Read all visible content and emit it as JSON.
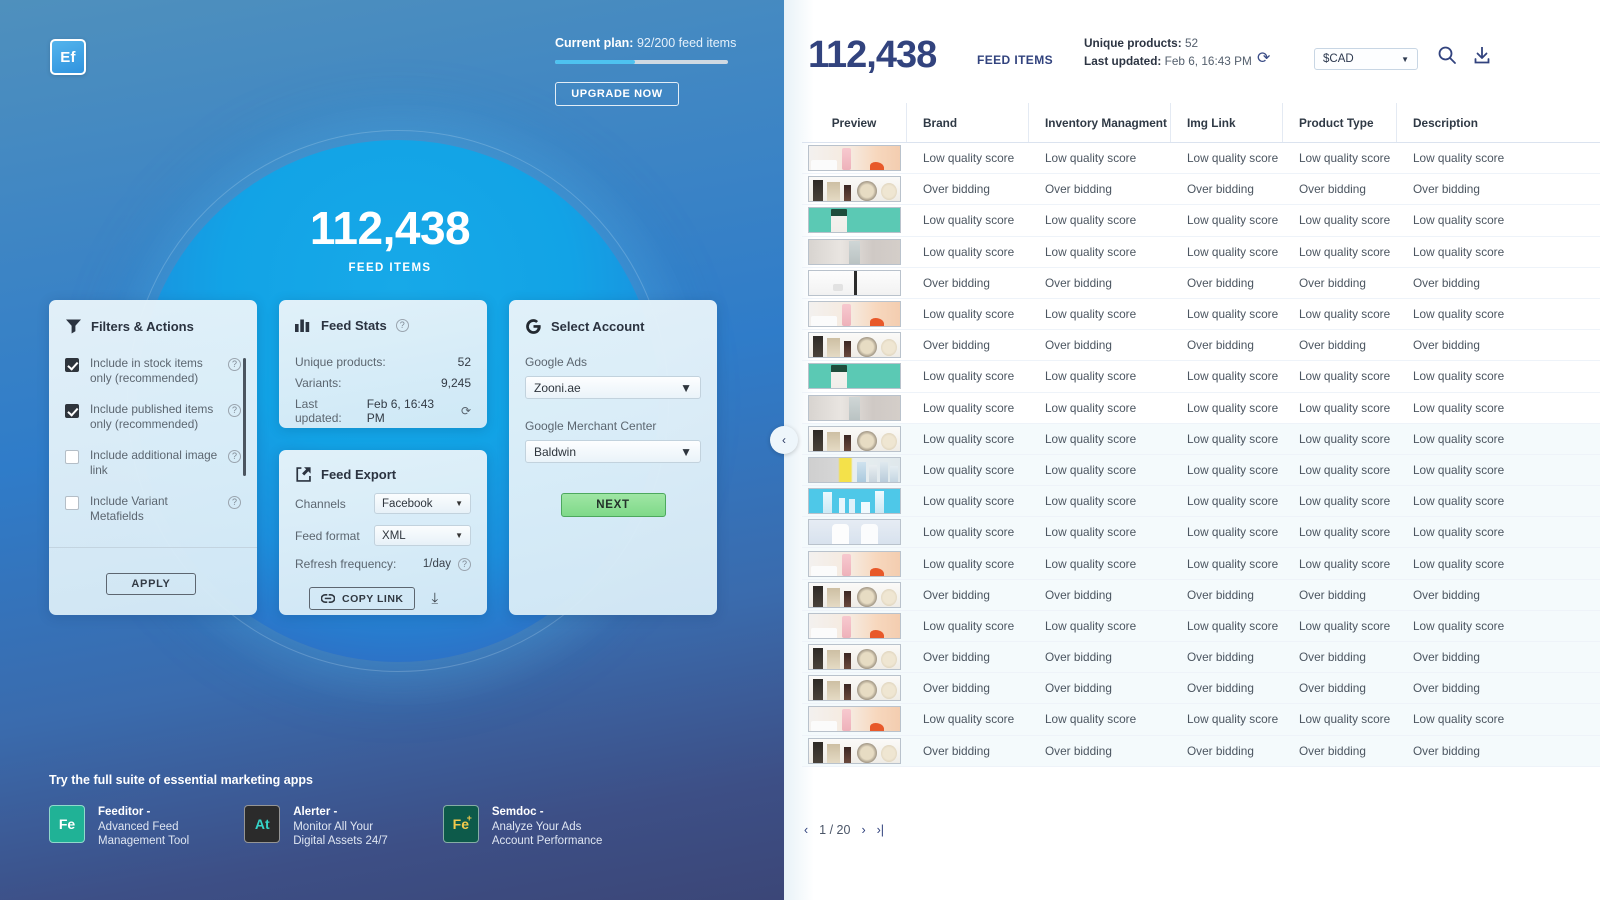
{
  "left": {
    "logo": "Ef",
    "plan": {
      "label": "Current plan:",
      "value": "92/200 feed items",
      "percent": 46
    },
    "upgrade_label": "UPGRADE NOW",
    "hero": {
      "number": "112,438",
      "label": "FEED ITEMS"
    },
    "filters_card": {
      "title": "Filters & Actions",
      "items": [
        {
          "label": "Include in stock items only (recommended)",
          "checked": true
        },
        {
          "label": "Include published items only (recommended)",
          "checked": true
        },
        {
          "label": "Include additional image link",
          "checked": false
        },
        {
          "label": "Include Variant Metafields",
          "checked": false
        }
      ],
      "apply_label": "APPLY"
    },
    "stats_card": {
      "title": "Feed Stats",
      "rows": [
        {
          "key": "Unique products:",
          "value": "52"
        },
        {
          "key": "Variants:",
          "value": "9,245"
        },
        {
          "key": "Last updated:",
          "value": "Feb 6, 16:43 PM"
        }
      ]
    },
    "export_card": {
      "title": "Feed Export",
      "channels_label": "Channels",
      "channels_value": "Facebook",
      "format_label": "Feed format",
      "format_value": "XML",
      "refresh_label": "Refresh frequency:",
      "refresh_value": "1/day",
      "copy_label": "COPY LINK"
    },
    "account_card": {
      "title": "Select Account",
      "google_ads_label": "Google Ads",
      "google_ads_value": "Zooni.ae",
      "gmc_label": "Google Merchant Center",
      "gmc_value": "Baldwin",
      "next_label": "NEXT"
    },
    "suite": {
      "title": "Try the full suite of essential marketing apps",
      "apps": [
        {
          "badge": "Fe",
          "sup": "",
          "name": "Feeditor -",
          "line1": "Advanced Feed",
          "line2": "Management Tool",
          "color": "#20b296",
          "text": "#ffffff"
        },
        {
          "badge": "At",
          "sup": "",
          "name": "Alerter -",
          "line1": "Monitor All Your",
          "line2": "Digital Assets 24/7",
          "color": "#2b2b2b",
          "text": "#35d4c8"
        },
        {
          "badge": "Fe",
          "sup": "+",
          "name": "Semdoc -",
          "line1": "Analyze Your Ads",
          "line2": "Account Performance",
          "color": "#0d5a4a",
          "text": "#f2c94c"
        }
      ]
    },
    "collapse_icon": "‹"
  },
  "right": {
    "number": "112,438",
    "number_label": "FEED ITEMS",
    "unique_label": "Unique products:",
    "unique_value": "52",
    "updated_label": "Last updated:",
    "updated_value": "Feb 6, 16:43 PM",
    "currency": "$CAD",
    "columns": [
      "Preview",
      "Brand",
      "Inventory Managment",
      "Img Link",
      "Product Type",
      "Description"
    ],
    "rows": [
      {
        "thumb": "pink",
        "status": "Low quality score"
      },
      {
        "thumb": "makeup",
        "status": "Over bidding"
      },
      {
        "thumb": "teal",
        "status": "Low quality score"
      },
      {
        "thumb": "beige",
        "status": "Low quality score"
      },
      {
        "thumb": "white",
        "status": "Over bidding"
      },
      {
        "thumb": "pink",
        "status": "Low quality score"
      },
      {
        "thumb": "makeup",
        "status": "Over bidding"
      },
      {
        "thumb": "teal",
        "status": "Low quality score"
      },
      {
        "thumb": "beige",
        "status": "Low quality score"
      },
      {
        "thumb": "makeup",
        "status": "Low quality score"
      },
      {
        "thumb": "yellow",
        "status": "Low quality score"
      },
      {
        "thumb": "cyan",
        "status": "Low quality score"
      },
      {
        "thumb": "oliver",
        "status": "Low quality score"
      },
      {
        "thumb": "pink",
        "status": "Low quality score"
      },
      {
        "thumb": "makeup",
        "status": "Over bidding"
      },
      {
        "thumb": "pink",
        "status": "Low quality score"
      },
      {
        "thumb": "makeup",
        "status": "Over bidding"
      },
      {
        "thumb": "makeup",
        "status": "Over bidding"
      },
      {
        "thumb": "pink",
        "status": "Low quality score"
      },
      {
        "thumb": "makeup",
        "status": "Over bidding"
      }
    ],
    "pager": {
      "prev": "‹",
      "page": "1 / 20",
      "next": "›",
      "last": "›|"
    }
  }
}
